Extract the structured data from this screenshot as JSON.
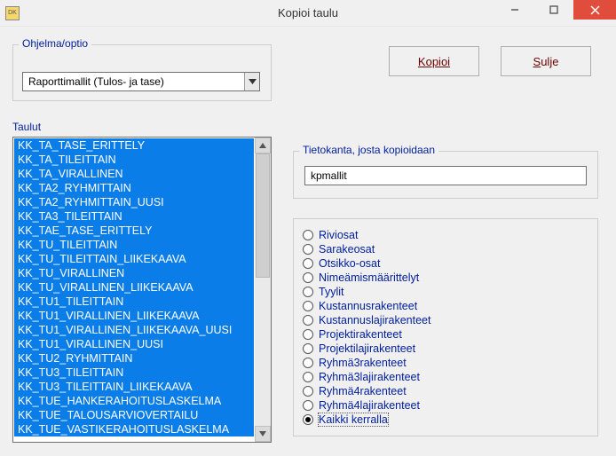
{
  "window": {
    "title": "Kopioi taulu",
    "icon_label": "DK"
  },
  "optio": {
    "legend": "Ohjelma/optio",
    "selected": "Raporttimallit (Tulos- ja tase)"
  },
  "buttons": {
    "copy": "Kopioi",
    "close": "Sulje"
  },
  "taulut": {
    "label": "Taulut",
    "items": [
      "KK_TA_TASE_ERITTELY",
      "KK_TA_TILEITTAIN",
      "KK_TA_VIRALLINEN",
      "KK_TA2_RYHMITTAIN",
      "KK_TA2_RYHMITTAIN_UUSI",
      "KK_TA3_TILEITTAIN",
      "KK_TAE_TASE_ERITTELY",
      "KK_TU_TILEITTAIN",
      "KK_TU_TILEITTAIN_LIIKEKAAVA",
      "KK_TU_VIRALLINEN",
      "KK_TU_VIRALLINEN_LIIKEKAAVA",
      "KK_TU1_TILEITTAIN",
      "KK_TU1_VIRALLINEN_LIIKEKAAVA",
      "KK_TU1_VIRALLINEN_LIIKEKAAVA_UUSI",
      "KK_TU1_VIRALLINEN_UUSI",
      "KK_TU2_RYHMITTAIN",
      "KK_TU3_TILEITTAIN",
      "KK_TU3_TILEITTAIN_LIIKEKAAVA",
      "KK_TUE_HANKERAHOITUSLASKELMA",
      "KK_TUE_TALOUSARVIOVERTAILU",
      "KK_TUE_VASTIKERAHOITUSLASKELMA"
    ]
  },
  "database": {
    "legend": "Tietokanta, josta kopioidaan",
    "value": "kpmallit"
  },
  "radios": {
    "items": [
      "Riviosat",
      "Sarakeosat",
      "Otsikko-osat",
      "Nimeämismäärittelyt",
      "Tyylit",
      "Kustannusrakenteet",
      "Kustannuslajirakenteet",
      "Projektirakenteet",
      "Projektilajirakenteet",
      "Ryhmä3rakenteet",
      "Ryhmä3lajirakenteet",
      "Ryhmä4rakenteet",
      "Ryhmä4lajirakenteet",
      "Kaikki kerralla"
    ],
    "selected_index": 13
  }
}
